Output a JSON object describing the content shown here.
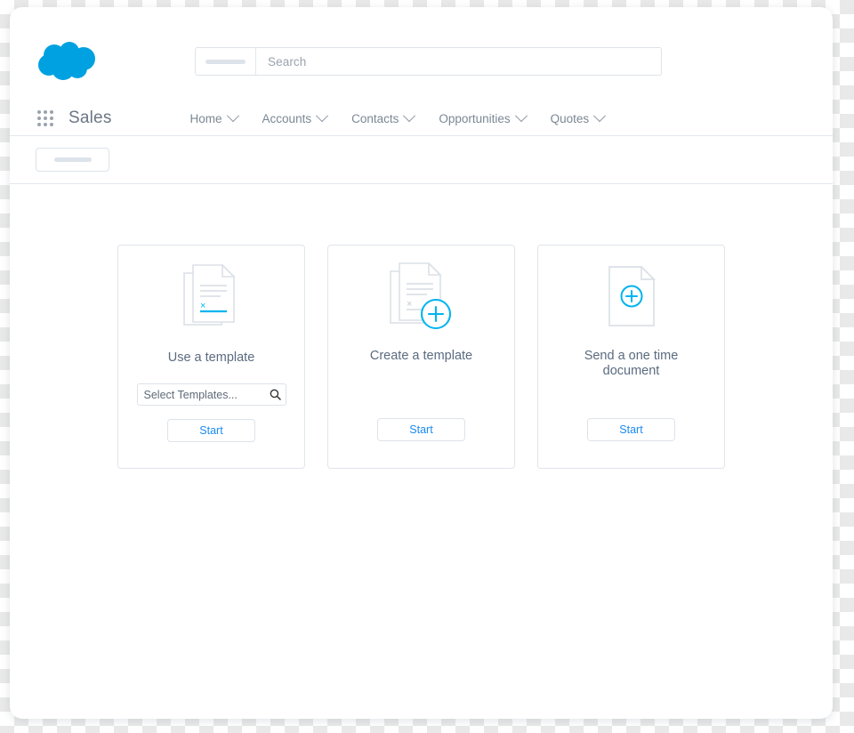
{
  "header": {
    "logo_icon": "salesforce-cloud-logo",
    "brand_color": "#00a1e0",
    "search": {
      "scope_redacted": true,
      "placeholder": "Search",
      "value": ""
    }
  },
  "app_bar": {
    "launcher_icon": "app-launcher-grid-icon",
    "app_name": "Sales",
    "nav_items": [
      {
        "label": "Home",
        "icon": "chevron-down-icon"
      },
      {
        "label": "Accounts",
        "icon": "chevron-down-icon"
      },
      {
        "label": "Contacts",
        "icon": "chevron-down-icon"
      },
      {
        "label": "Opportunities",
        "icon": "chevron-down-icon"
      },
      {
        "label": "Quotes",
        "icon": "chevron-down-icon"
      }
    ]
  },
  "sub_header": {
    "pill_redacted": true
  },
  "main": {
    "cards": [
      {
        "id": "use-a-template",
        "icon": "stacked-document-signature-icon",
        "title": "Use a template",
        "select_input": {
          "placeholder": "Select Templates...",
          "value": "",
          "icon": "search-icon"
        },
        "button_label": "Start"
      },
      {
        "id": "create-a-template",
        "icon": "stacked-document-plus-icon",
        "title": "Create a template",
        "button_label": "Start"
      },
      {
        "id": "send-one-time-document",
        "icon": "document-plus-icon",
        "title": "Send a one time\ndocument",
        "button_label": "Start"
      }
    ]
  },
  "colors": {
    "accent_blue": "#00a1e0",
    "link_blue": "#1b8bf0",
    "text_slate": "#5b6b80",
    "border_grey": "#e0e5eb"
  }
}
